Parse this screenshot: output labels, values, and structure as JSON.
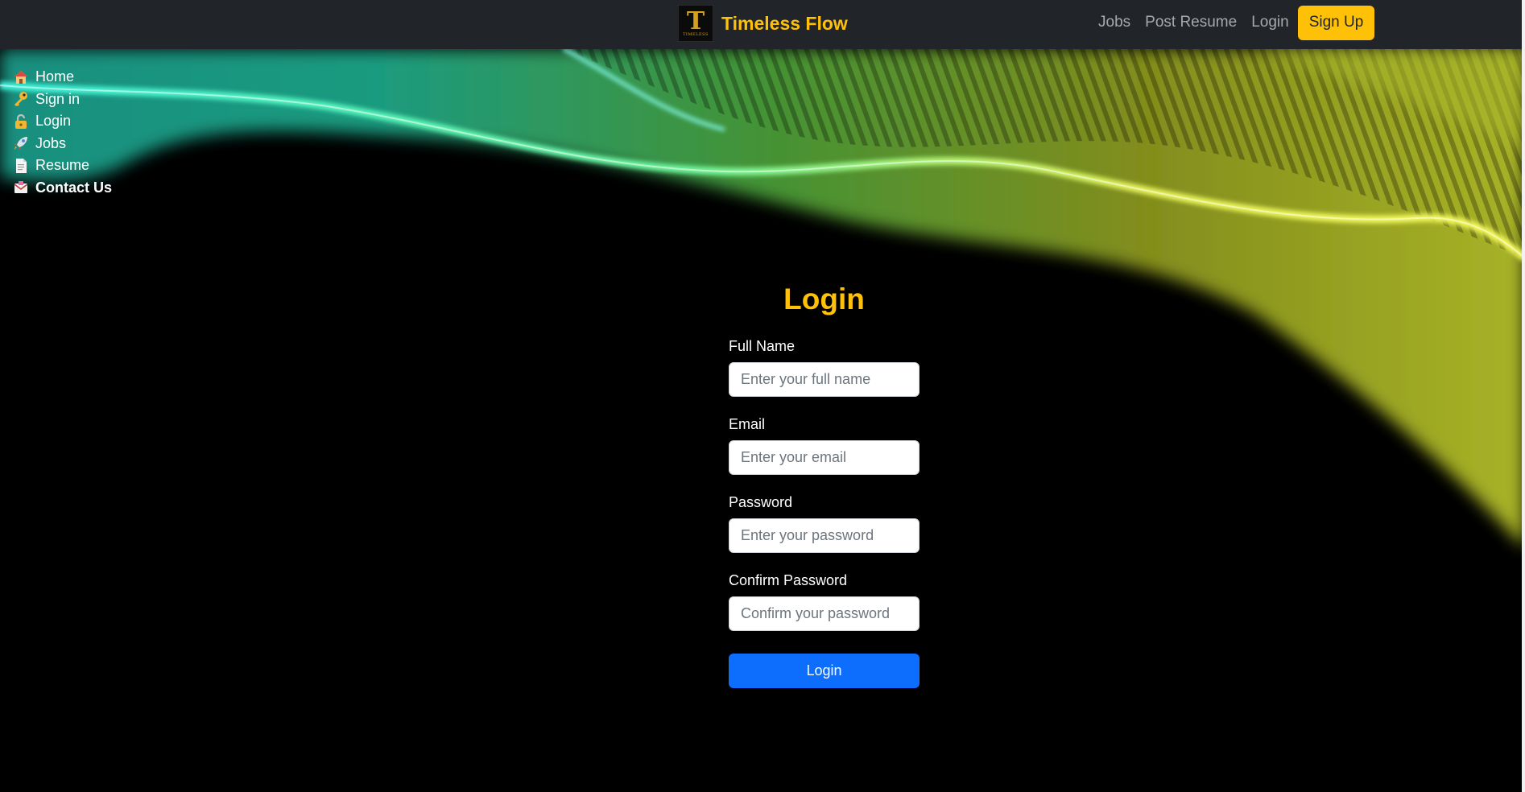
{
  "navbar": {
    "brand_name": "Timeless Flow",
    "logo_letter": "T",
    "logo_small_text": "TIMELESS",
    "links": [
      "Jobs",
      "Post Resume",
      "Login"
    ],
    "signup_label": "Sign Up",
    "colors": {
      "bar": "#212529",
      "accent": "#ffc107"
    }
  },
  "sidebar": {
    "items": [
      {
        "label": "Home",
        "icon": "house-icon"
      },
      {
        "label": "Sign in",
        "icon": "key-icon"
      },
      {
        "label": "Login",
        "icon": "lock-icon"
      },
      {
        "label": "Jobs",
        "icon": "rocket-icon"
      },
      {
        "label": "Resume",
        "icon": "document-icon"
      },
      {
        "label": "Contact Us",
        "icon": "envelope-icon"
      }
    ]
  },
  "form": {
    "title": "Login",
    "fields": {
      "full_name": {
        "label": "Full Name",
        "placeholder": "Enter your full name"
      },
      "email": {
        "label": "Email",
        "placeholder": "Enter your email"
      },
      "password": {
        "label": "Password",
        "placeholder": "Enter your password"
      },
      "confirm_password": {
        "label": "Confirm Password",
        "placeholder": "Confirm your password"
      }
    },
    "submit_label": "Login",
    "colors": {
      "title": "#ffc107",
      "button": "#0d6efd"
    }
  }
}
